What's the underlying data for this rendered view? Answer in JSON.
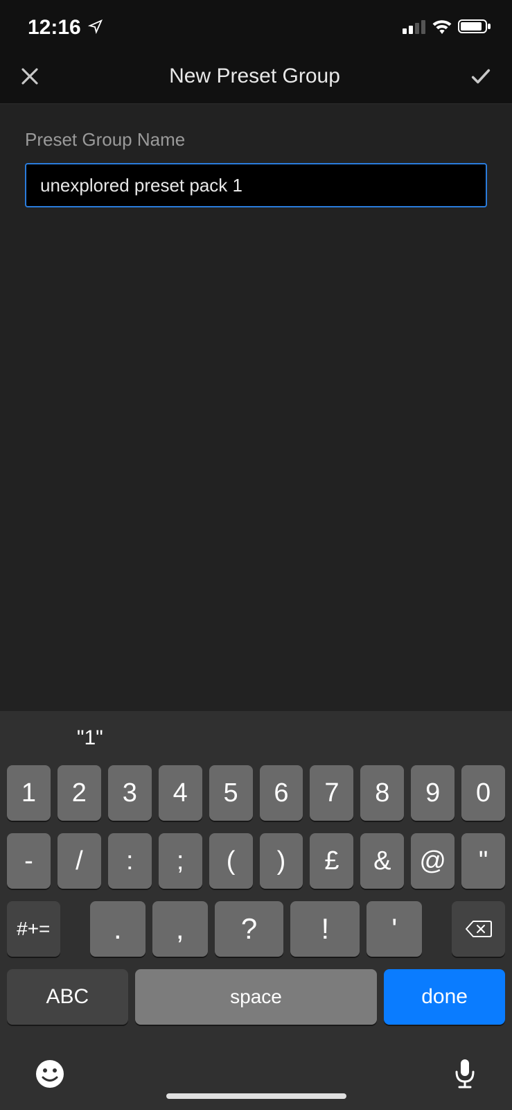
{
  "status_bar": {
    "time": "12:16"
  },
  "nav": {
    "title": "New Preset Group"
  },
  "form": {
    "label": "Preset Group Name",
    "value": "unexplored preset pack 1"
  },
  "keyboard": {
    "suggestions": [
      "\"1\"",
      "",
      ""
    ],
    "row1": [
      "1",
      "2",
      "3",
      "4",
      "5",
      "6",
      "7",
      "8",
      "9",
      "0"
    ],
    "row2": [
      "-",
      "/",
      ":",
      ";",
      "(",
      ")",
      "£",
      "&",
      "@",
      "\""
    ],
    "row3": {
      "alt_label": "#+=",
      "punct": [
        ".",
        ",",
        "?",
        "!",
        "'"
      ]
    },
    "row4": {
      "abc_label": "ABC",
      "space_label": "space",
      "done_label": "done"
    }
  },
  "icons": {
    "location": "location-arrow-icon",
    "signal": "cellular-signal-icon",
    "wifi": "wifi-icon",
    "battery": "battery-icon",
    "close": "close-icon",
    "check": "check-icon",
    "backspace": "backspace-icon",
    "emoji": "emoji-icon",
    "mic": "mic-icon"
  }
}
